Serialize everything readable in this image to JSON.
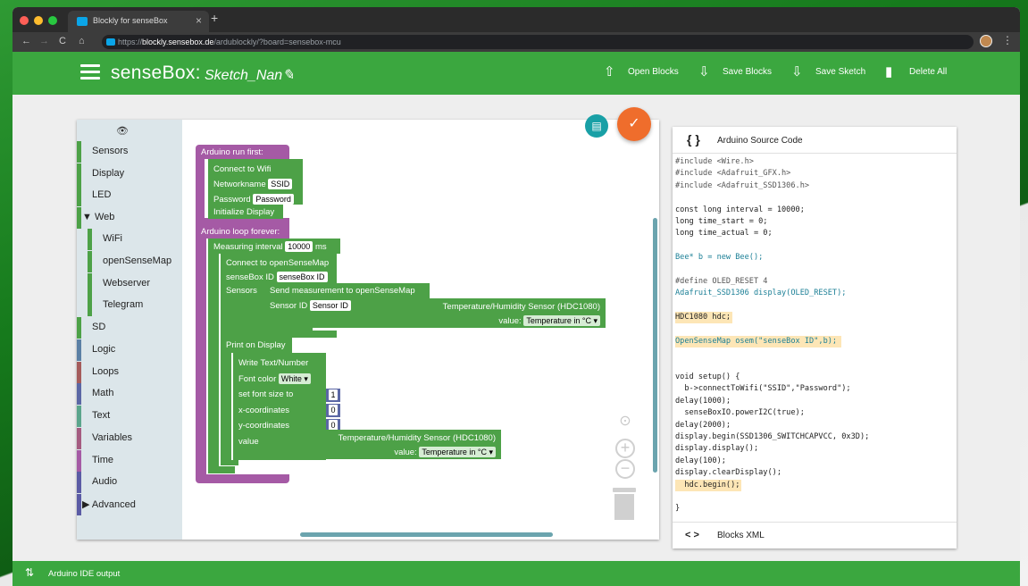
{
  "browser": {
    "tab_title": "Blockly for senseBox",
    "url_prefix": "https://",
    "url_host": "blockly.sensebox.de",
    "url_path": "/ardublockly/?board=sensebox-mcu"
  },
  "appbar": {
    "brand": "senseBox:",
    "sketch_name": "Sketch_Nan",
    "open_blocks": "Open Blocks",
    "save_blocks": "Save Blocks",
    "save_sketch": "Save Sketch",
    "delete_all": "Delete All",
    "accent": "#3ba73f"
  },
  "toolbox": [
    {
      "label": "Sensors",
      "color": "#4da147"
    },
    {
      "label": "Display",
      "color": "#4da147"
    },
    {
      "label": "LED",
      "color": "#4da147"
    },
    {
      "label": "▼ Web",
      "color": "#4da147"
    },
    {
      "label": "WiFi",
      "color": "#4da147"
    },
    {
      "label": "openSenseMap",
      "color": "#4da147"
    },
    {
      "label": "Webserver",
      "color": "#4da147"
    },
    {
      "label": "Telegram",
      "color": "#4da147"
    },
    {
      "label": "SD",
      "color": "#4da147"
    },
    {
      "label": "Logic",
      "color": "#5b80a5"
    },
    {
      "label": "Loops",
      "color": "#a55b5b"
    },
    {
      "label": "Math",
      "color": "#5b67a5"
    },
    {
      "label": "Text",
      "color": "#5ba58c"
    },
    {
      "label": "Variables",
      "color": "#a55b80"
    },
    {
      "label": "Time",
      "color": "#a55aa5"
    },
    {
      "label": "Audio",
      "color": "#5b5ba5"
    },
    {
      "label": "▶ Advanced",
      "color": "#5b5ba5"
    }
  ],
  "blocks": {
    "run_first": "Arduino run first:",
    "connect_wifi": "Connect to Wifi",
    "networkname": "Networkname",
    "ssid": "SSID",
    "password": "Password",
    "password_val": "Password",
    "init_display": "Initialize Display",
    "loop_forever": "Arduino loop forever:",
    "measuring_interval": "Measuring interval",
    "interval_val": "10000",
    "ms": "ms",
    "connect_osm": "Connect to openSenseMap",
    "sensebox_id": "senseBox ID",
    "sensebox_id_val": "senseBox ID",
    "sensors": "Sensors",
    "send_measurement": "Send measurement to openSenseMap",
    "sensor_id": "Sensor ID",
    "sensor_id_val": "Sensor ID",
    "temp_sensor": "Temperature/Humidity Sensor (HDC1080)",
    "value": "value:",
    "temp_unit": "Temperature in °C",
    "print_display": "Print on Display",
    "write_text": "Write Text/Number",
    "font_color": "Font color",
    "white": "White",
    "font_size": "set font size to",
    "font_size_val": "1",
    "x_coord": "x-coordinates",
    "x_val": "0",
    "y_coord": "y-coordinates",
    "y_val": "0",
    "value_label": "value",
    "temp_sensor2": "Temperature/Humidity Sensor (HDC1080)",
    "value2": "value:",
    "temp_unit2": "Temperature in °C"
  },
  "code_panel": {
    "title": "Arduino Source Code",
    "xml_label": "Blocks XML",
    "lines": [
      "#include <Wire.h>",
      "#include <Adafruit_GFX.h>",
      "#include <Adafruit_SSD1306.h>",
      "",
      "const long interval = 10000;",
      "long time_start = 0;",
      "long time_actual = 0;",
      "",
      "Bee* b = new Bee();",
      "",
      "#define OLED_RESET 4",
      "Adafruit_SSD1306 display(OLED_RESET);",
      "",
      "HDC1080 hdc;",
      "",
      "OpenSenseMap osem(\"senseBox ID\",b);",
      "",
      "",
      "void setup() {",
      "  b->connectToWifi(\"SSID\",\"Password\");",
      "delay(1000);",
      "  senseBoxIO.powerI2C(true);",
      "delay(2000);",
      "display.begin(SSD1306_SWITCHCAPVCC, 0x3D);",
      "display.display();",
      "delay(100);",
      "display.clearDisplay();",
      "  hdc.begin();",
      "",
      "}"
    ]
  },
  "footer": {
    "label": "Arduino IDE output"
  }
}
